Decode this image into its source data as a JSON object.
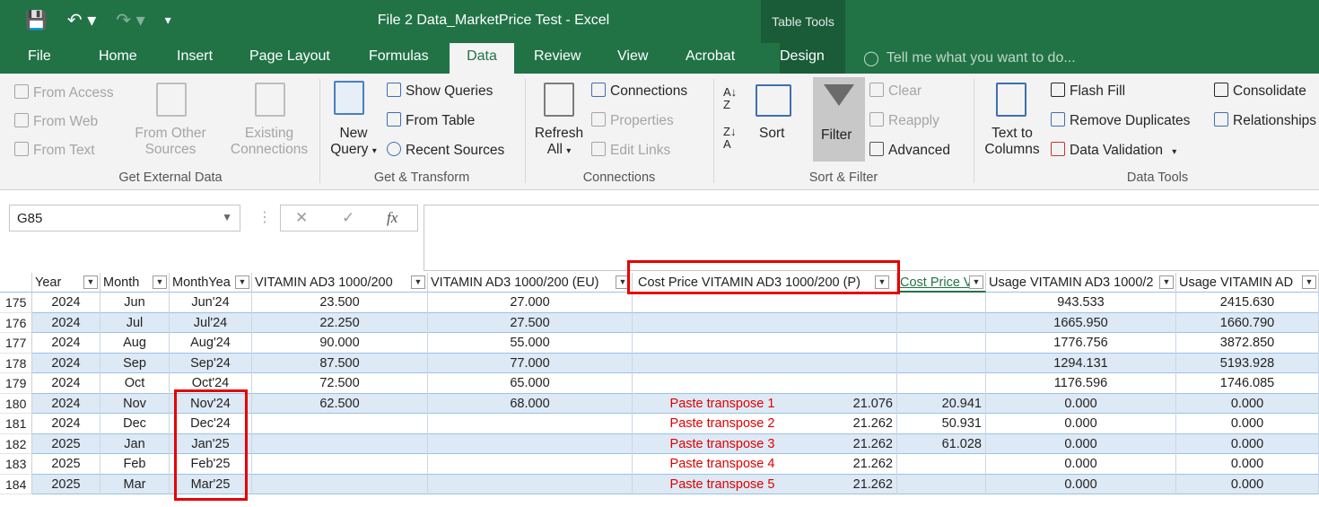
{
  "window": {
    "title": "File 2 Data_MarketPrice Test - Excel",
    "table_tools": "Table Tools"
  },
  "tabs": [
    "File",
    "Home",
    "Insert",
    "Page Layout",
    "Formulas",
    "Data",
    "Review",
    "View",
    "Acrobat",
    "Design"
  ],
  "tell_me": "Tell me what you want to do...",
  "ribbon": {
    "external": {
      "from_access": "From Access",
      "from_web": "From Web",
      "from_text": "From Text",
      "from_other_1": "From Other",
      "from_other_2": "Sources",
      "existing_1": "Existing",
      "existing_2": "Connections",
      "label": "Get External Data"
    },
    "transform": {
      "new_1": "New",
      "new_2": "Query",
      "show_queries": "Show Queries",
      "from_table": "From Table",
      "recent_sources": "Recent Sources",
      "label": "Get & Transform"
    },
    "connections": {
      "refresh_1": "Refresh",
      "refresh_2": "All",
      "connections": "Connections",
      "properties": "Properties",
      "edit_links": "Edit Links",
      "label": "Connections"
    },
    "sortfilter": {
      "sort": "Sort",
      "filter": "Filter",
      "clear": "Clear",
      "reapply": "Reapply",
      "advanced": "Advanced",
      "label": "Sort & Filter"
    },
    "datatools": {
      "text_1": "Text to",
      "text_2": "Columns",
      "flash_fill": "Flash Fill",
      "remove_duplicates": "Remove Duplicates",
      "data_validation": "Data Validation",
      "consolidate": "Consolidate",
      "relationships": "Relationships",
      "label": "Data Tools"
    }
  },
  "formula_bar": {
    "name_box": "G85",
    "fx": "fx",
    "formula": ""
  },
  "headers": [
    "Year",
    "Month",
    "MonthYea",
    "VITAMIN AD3 1000/200",
    "VITAMIN AD3 1000/200 (EU)",
    "Cost Price VITAMIN AD3 1000/200 (P)",
    "Cost Price V",
    "Usage VITAMIN AD3 1000/2",
    "Usage VITAMIN AD"
  ],
  "rows": [
    {
      "n": "175",
      "year": "2024",
      "month": "Jun",
      "my": "Jun'24",
      "v1": "23.500",
      "v2": "27.000",
      "note": "",
      "cp": "",
      "cpv": "",
      "u1": "943.533",
      "u2": "2415.630"
    },
    {
      "n": "176",
      "year": "2024",
      "month": "Jul",
      "my": "Jul'24",
      "v1": "22.250",
      "v2": "27.500",
      "note": "",
      "cp": "",
      "cpv": "",
      "u1": "1665.950",
      "u2": "1660.790"
    },
    {
      "n": "177",
      "year": "2024",
      "month": "Aug",
      "my": "Aug'24",
      "v1": "90.000",
      "v2": "55.000",
      "note": "",
      "cp": "",
      "cpv": "",
      "u1": "1776.756",
      "u2": "3872.850"
    },
    {
      "n": "178",
      "year": "2024",
      "month": "Sep",
      "my": "Sep'24",
      "v1": "87.500",
      "v2": "77.000",
      "note": "",
      "cp": "",
      "cpv": "",
      "u1": "1294.131",
      "u2": "5193.928"
    },
    {
      "n": "179",
      "year": "2024",
      "month": "Oct",
      "my": "Oct'24",
      "v1": "72.500",
      "v2": "65.000",
      "note": "",
      "cp": "",
      "cpv": "",
      "u1": "1176.596",
      "u2": "1746.085"
    },
    {
      "n": "180",
      "year": "2024",
      "month": "Nov",
      "my": "Nov'24",
      "v1": "62.500",
      "v2": "68.000",
      "note": "Paste transpose 1",
      "cp": "21.076",
      "cpv": "20.941",
      "u1": "0.000",
      "u2": "0.000"
    },
    {
      "n": "181",
      "year": "2024",
      "month": "Dec",
      "my": "Dec'24",
      "v1": "",
      "v2": "",
      "note": "Paste transpose 2",
      "cp": "21.262",
      "cpv": "50.931",
      "u1": "0.000",
      "u2": "0.000"
    },
    {
      "n": "182",
      "year": "2025",
      "month": "Jan",
      "my": "Jan'25",
      "v1": "",
      "v2": "",
      "note": "Paste transpose 3",
      "cp": "21.262",
      "cpv": "61.028",
      "u1": "0.000",
      "u2": "0.000"
    },
    {
      "n": "183",
      "year": "2025",
      "month": "Feb",
      "my": "Feb'25",
      "v1": "",
      "v2": "",
      "note": "Paste transpose 4",
      "cp": "21.262",
      "cpv": "",
      "u1": "0.000",
      "u2": "0.000"
    },
    {
      "n": "184",
      "year": "2025",
      "month": "Mar",
      "my": "Mar'25",
      "v1": "",
      "v2": "",
      "note": "Paste transpose 5",
      "cp": "21.262",
      "cpv": "",
      "u1": "0.000",
      "u2": "0.000"
    }
  ],
  "colors": {
    "excel_green": "#217346",
    "band_blue": "#dde9f5",
    "highlight_red": "#e60000"
  }
}
